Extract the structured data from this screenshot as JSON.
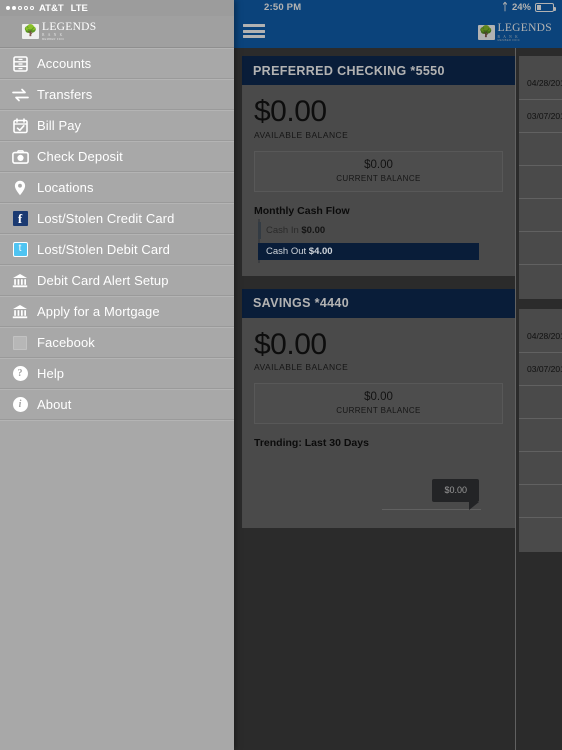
{
  "status_bar": {
    "carrier": "AT&T",
    "network": "LTE",
    "time": "2:50 PM",
    "battery_percent": "24%",
    "bluetooth_icon": "bluetooth-icon",
    "battery_icon": "battery-icon"
  },
  "brand": {
    "name": "LEGENDS",
    "subtitle": "B  A  N  K",
    "tagline": "MEMBER FDIC",
    "emblem_icon": "tree-emblem-icon"
  },
  "appbar": {
    "menu_icon": "hamburger-menu-icon"
  },
  "drawer": {
    "items": [
      {
        "label": "Accounts",
        "icon": "accounts-icon"
      },
      {
        "label": "Transfers",
        "icon": "transfers-arrows-icon"
      },
      {
        "label": "Bill Pay",
        "icon": "calendar-check-icon"
      },
      {
        "label": "Check Deposit",
        "icon": "camera-icon"
      },
      {
        "label": "Locations",
        "icon": "map-pin-icon"
      },
      {
        "label": "Lost/Stolen Credit Card",
        "icon": "facebook-icon"
      },
      {
        "label": "Lost/Stolen Debit Card",
        "icon": "twitter-icon"
      },
      {
        "label": "Debit Card Alert Setup",
        "icon": "bank-building-icon"
      },
      {
        "label": "Apply for a Mortgage",
        "icon": "bank-building-icon"
      },
      {
        "label": "Facebook",
        "icon": "blank-square-icon"
      },
      {
        "label": "Help",
        "icon": "question-circle-icon"
      },
      {
        "label": "About",
        "icon": "info-circle-icon"
      }
    ]
  },
  "accounts": [
    {
      "title": "PREFERRED CHECKING *5550",
      "available_balance": "$0.00",
      "available_label": "AVAILABLE BALANCE",
      "current_balance": "$0.00",
      "current_label": "CURRENT BALANCE",
      "section_title": "Monthly Cash Flow",
      "cash_in_label": "Cash In",
      "cash_in_value": "$0.00",
      "cash_out_label": "Cash Out",
      "cash_out_value": "$4.00"
    },
    {
      "title": "SAVINGS *4440",
      "available_balance": "$0.00",
      "available_label": "AVAILABLE BALANCE",
      "current_balance": "$0.00",
      "current_label": "CURRENT BALANCE",
      "section_title": "Trending: Last 30 Days",
      "tooltip_value": "$0.00"
    }
  ],
  "transactions": {
    "checking_dates": [
      "04/28/201",
      "03/07/201"
    ],
    "savings_dates": [
      "04/28/201",
      "03/07/201"
    ]
  },
  "chart_data": [
    {
      "type": "bar",
      "title": "Monthly Cash Flow",
      "orientation": "horizontal",
      "categories": [
        "Cash In",
        "Cash Out"
      ],
      "values": [
        0.0,
        4.0
      ],
      "value_labels": [
        "$0.00",
        "$4.00"
      ],
      "xlabel": "",
      "ylabel": "",
      "xlim": [
        0,
        4
      ],
      "grid": false,
      "legend": "none",
      "colors": [
        "#4a5560",
        "#0d2a52"
      ],
      "account": "PREFERRED CHECKING *5550"
    },
    {
      "type": "line",
      "title": "Trending: Last 30 Days",
      "x": [
        "day 1",
        "day 30"
      ],
      "values": [
        0.0,
        0.0
      ],
      "annotations": [
        {
          "label": "$0.00",
          "x": "day 30",
          "y": 0.0
        }
      ],
      "xlabel": "",
      "ylabel": "",
      "ylim": [
        0,
        0
      ],
      "grid": false,
      "legend": "none",
      "account": "SAVINGS *4440"
    }
  ],
  "colors": {
    "appbar_blue": "#1061b0",
    "card_header_navy": "#0d2a52",
    "card_body_gray": "#6b6b6b",
    "drawer_gray": "#a8a8a8",
    "page_background": "#3e3e3e"
  }
}
